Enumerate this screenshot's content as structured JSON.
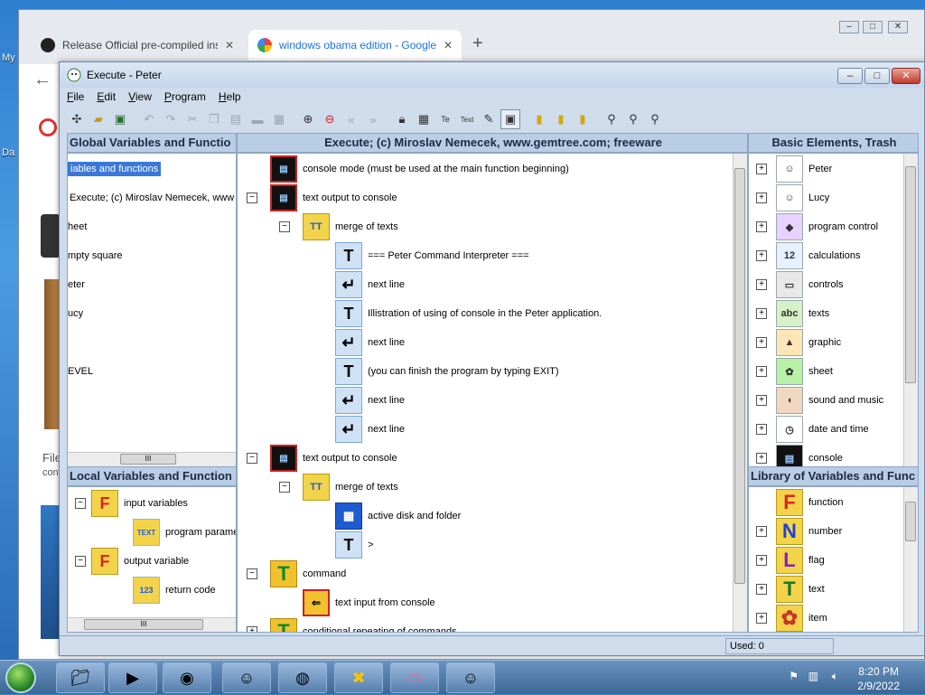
{
  "desktop": {
    "labels": [
      "My",
      "Da"
    ]
  },
  "browser": {
    "tabs": [
      {
        "title": "Release Official pre-compiled ins",
        "close": "✕"
      },
      {
        "title": "windows obama edition - Google",
        "close": "✕"
      }
    ],
    "new_tab": "+",
    "back": "←",
    "bg_fragments": [
      "File",
      "con"
    ]
  },
  "app": {
    "title": "Execute - Peter",
    "menu": [
      "File",
      "Edit",
      "View",
      "Program",
      "Help"
    ],
    "left_top": {
      "header": "Global Variables and Functio",
      "items": [
        {
          "label": "iables and functions",
          "selected": true
        },
        {
          "label": "Execute;   (c) Miroslav Nemecek, www"
        },
        {
          "label": "heet"
        },
        {
          "label": "mpty square"
        },
        {
          "label": "eter"
        },
        {
          "label": "ucy"
        },
        {
          "label": ""
        },
        {
          "label": "EVEL"
        }
      ],
      "hscroll_thumb": "III"
    },
    "left_bottom": {
      "header": "Local Variables and Function",
      "items": [
        {
          "label": "input variables",
          "icon": "F"
        },
        {
          "label": "program parame",
          "icon": "TEXT"
        },
        {
          "label": "output variable",
          "icon": "F"
        },
        {
          "label": "return code",
          "icon": "123"
        }
      ],
      "hscroll_thumb": "III"
    },
    "center": {
      "header": "Execute;   (c) Miroslav Nemecek, www.gemtree.com;    freeware",
      "nodes": [
        {
          "label": "console mode (must be used at the main function beginning)",
          "icon": "console"
        },
        {
          "label": "text output to console",
          "icon": "console",
          "tree": "−"
        },
        {
          "label": "merge of texts",
          "icon": "merge",
          "tree": "−"
        },
        {
          "label": "=== Peter Command Interpreter ===",
          "icon": "T"
        },
        {
          "label": "next line",
          "icon": "enter"
        },
        {
          "label": "Illistration of using of console in the Peter application.",
          "icon": "T"
        },
        {
          "label": "next line",
          "icon": "enter"
        },
        {
          "label": "(you can finish the program by typing EXIT)",
          "icon": "T"
        },
        {
          "label": "next line",
          "icon": "enter"
        },
        {
          "label": "next line",
          "icon": "enter"
        },
        {
          "label": "text output to console",
          "icon": "console",
          "tree": "−"
        },
        {
          "label": "merge of texts",
          "icon": "merge",
          "tree": "−"
        },
        {
          "label": "active disk and folder",
          "icon": "disk"
        },
        {
          "label": ">",
          "icon": "T"
        },
        {
          "label": "command",
          "icon": "cmd",
          "tree": "−"
        },
        {
          "label": "text input from console",
          "icon": "input"
        },
        {
          "label": "conditional repeating of commands",
          "icon": "cmd",
          "tree": "+"
        }
      ]
    },
    "right_top": {
      "header": "Basic Elements, Trash",
      "items": [
        "Peter",
        "Lucy",
        "program control",
        "calculations",
        "controls",
        "texts",
        "graphic",
        "sheet",
        "sound and music",
        "date and time",
        "console"
      ]
    },
    "right_bottom": {
      "header": "Library of Variables and Func",
      "items": [
        {
          "label": "function",
          "icon": "F",
          "color": "#d8261c"
        },
        {
          "label": "number",
          "icon": "N",
          "color": "#1f3fd8"
        },
        {
          "label": "flag",
          "icon": "L",
          "color": "#8a1fb8"
        },
        {
          "label": "text",
          "icon": "T",
          "color": "#117a2a"
        },
        {
          "label": "item",
          "icon": "✿",
          "color": "#c0392b"
        }
      ]
    },
    "status": {
      "used": "Used: 0"
    }
  },
  "taskbar": {
    "time": "8:20 PM",
    "date": "2/9/2022"
  }
}
